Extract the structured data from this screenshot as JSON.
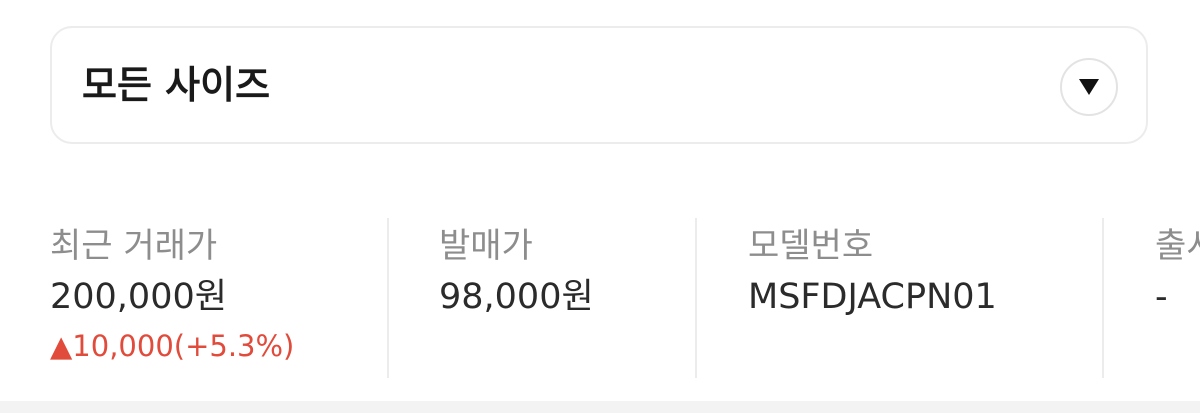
{
  "size_selector": {
    "label": "모든 사이즈",
    "dropdown_icon": "triangle-down-icon"
  },
  "info": [
    {
      "label": "최근 거래가",
      "value": "200,000원",
      "change": "▲10,000(+5.3%)",
      "change_color": "#e14b3b"
    },
    {
      "label": "발매가",
      "value": "98,000원"
    },
    {
      "label": "모델번호",
      "value": "MSFDJACPN01"
    },
    {
      "label": "출시",
      "value": "-"
    }
  ]
}
